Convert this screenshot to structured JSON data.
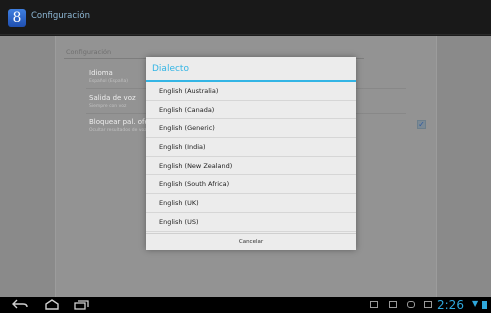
{
  "app": {
    "icon": "8",
    "title": "Configuración"
  },
  "settings": {
    "section_header": "Configuración",
    "items": [
      {
        "title": "Idioma",
        "summary": "Español (España)"
      },
      {
        "title": "Salida de voz",
        "summary": "Siempre con voz"
      },
      {
        "title": "Bloquear pal. ofensivas",
        "summary": "Ocultar resultados de voz ofensivos"
      }
    ],
    "checkbox_checked": true
  },
  "dialog": {
    "title": "Dialecto",
    "options": [
      "English (Australia)",
      "English (Canada)",
      "English (Generic)",
      "English (India)",
      "English (New Zealand)",
      "English (South Africa)",
      "English (UK)",
      "English (US)"
    ],
    "cancel_label": "Cancelar"
  },
  "systembar": {
    "time": "2:26",
    "nav_icons": [
      "back-icon",
      "home-icon",
      "recent-apps-icon"
    ],
    "status_icons": [
      "screenshot-icon",
      "gallery-icon",
      "usb-icon",
      "storage-icon",
      "wifi-icon",
      "battery-icon"
    ]
  },
  "colors": {
    "accent": "#33b5e5",
    "clock": "#2fa8dd"
  }
}
